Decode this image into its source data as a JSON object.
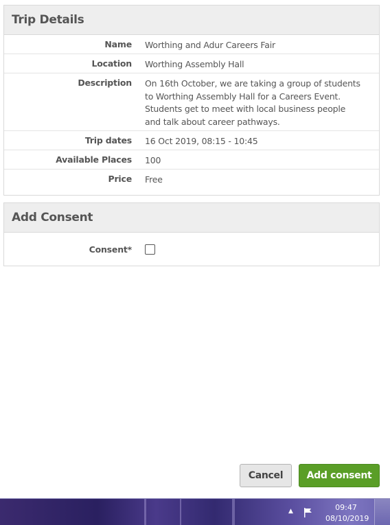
{
  "trip_details": {
    "heading": "Trip Details",
    "rows": [
      {
        "label": "Name",
        "value": "Worthing and Adur Careers Fair"
      },
      {
        "label": "Location",
        "value": "Worthing Assembly Hall"
      },
      {
        "label": "Description",
        "value_lines": [
          "On 16th October, we are taking a group of students",
          "to Worthing Assembly Hall for a Careers Event.",
          "Students get to meet with local business people",
          "and talk about career pathways."
        ]
      },
      {
        "label": "Trip dates",
        "value": "16 Oct 2019, 08:15 - 10:45"
      },
      {
        "label": "Available Places",
        "value": "100"
      },
      {
        "label": "Price",
        "value": "Free"
      }
    ]
  },
  "add_consent": {
    "heading": "Add Consent",
    "consent_label": "Consent*",
    "consent_checked": false
  },
  "actions": {
    "cancel_label": "Cancel",
    "submit_label": "Add consent",
    "submit_color": "#5a9e27"
  },
  "taskbar": {
    "time": "09:47",
    "date": "08/10/2019",
    "tray_icons": [
      "chevron-up-icon",
      "action-center-flag-icon"
    ]
  }
}
